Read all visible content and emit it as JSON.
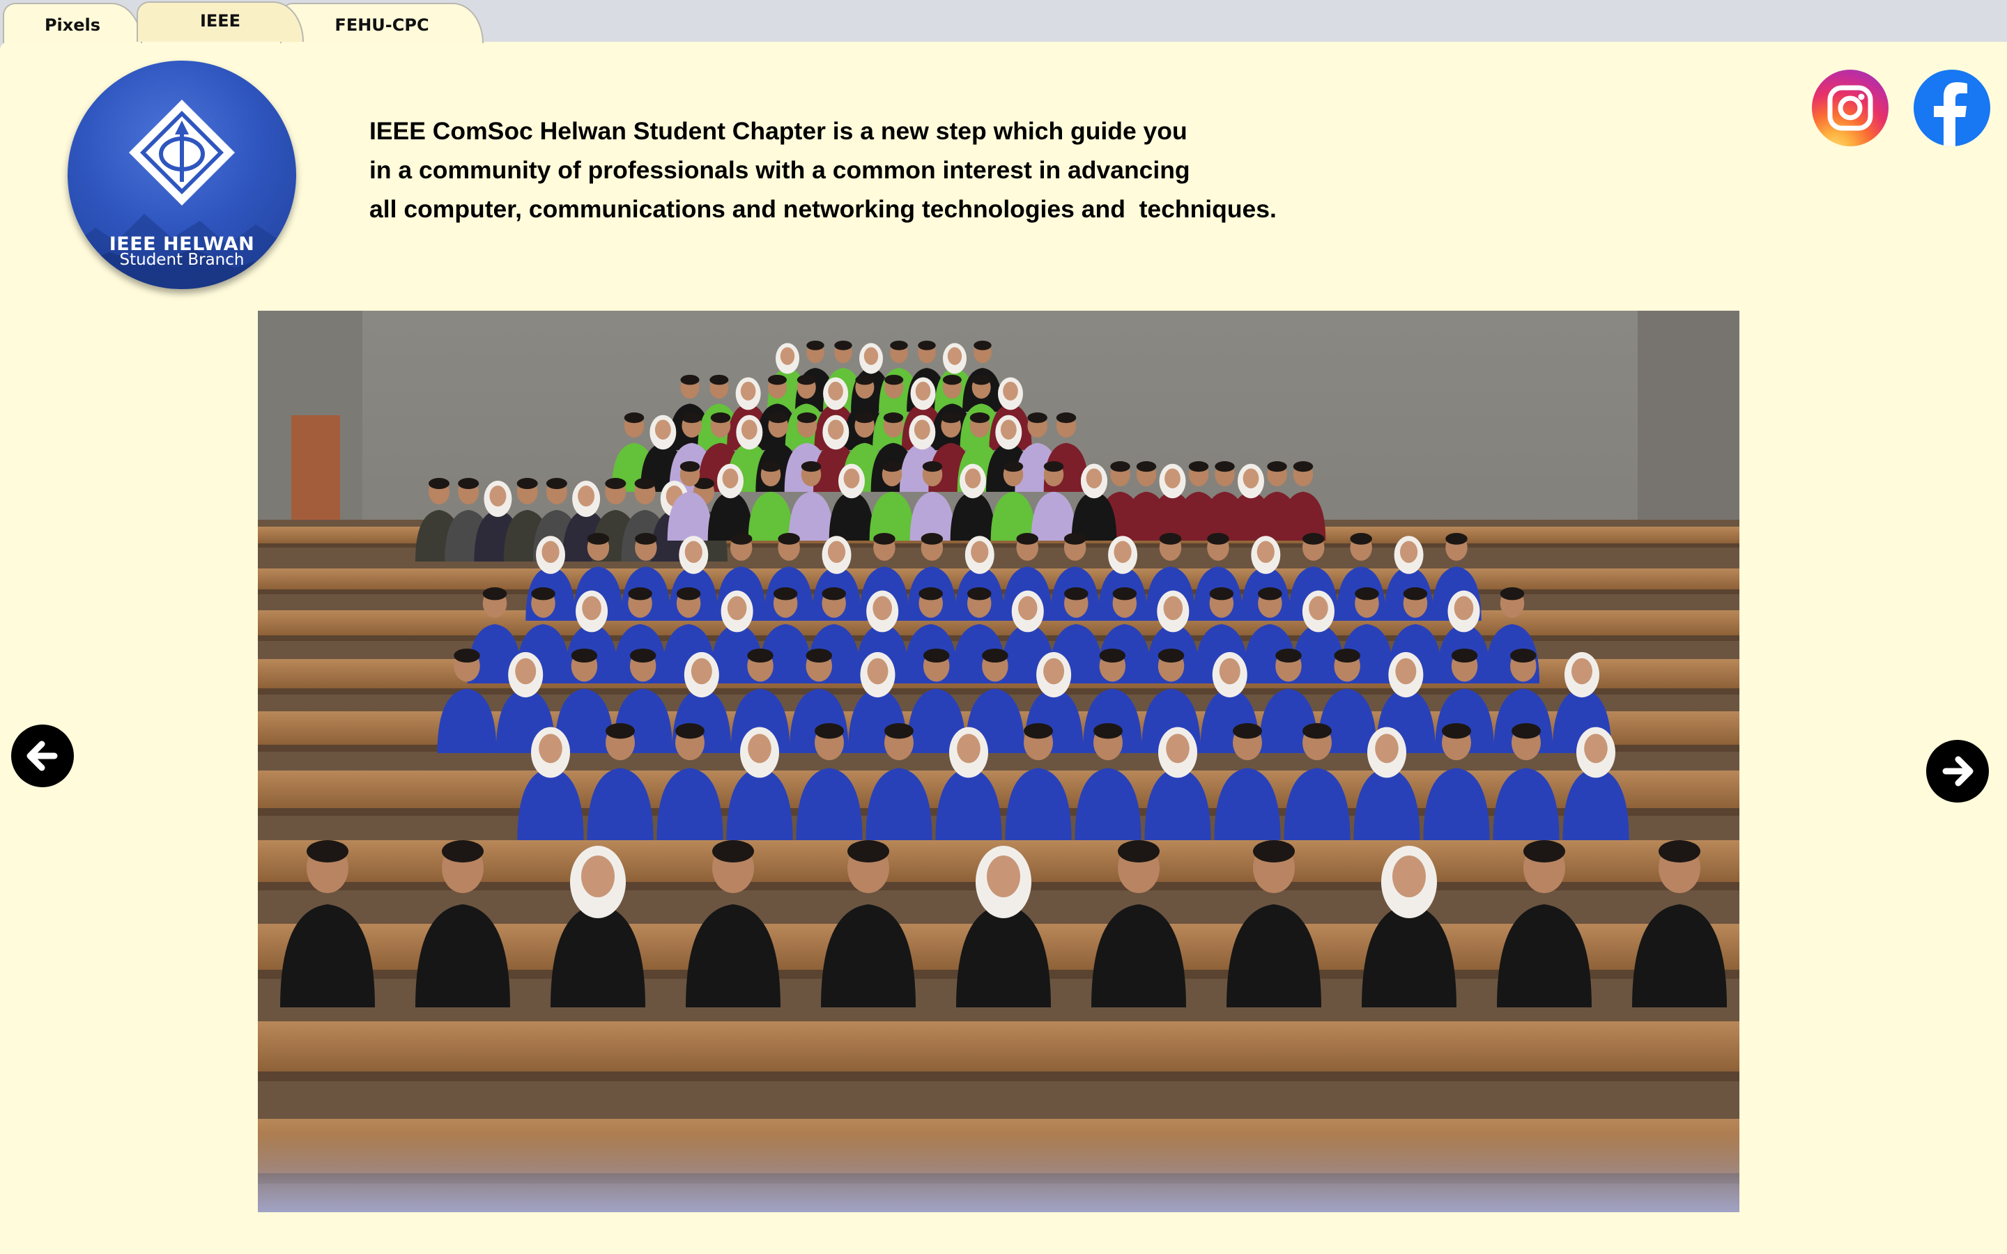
{
  "tabs": [
    {
      "label": "Pixels",
      "active": false
    },
    {
      "label": "IEEE",
      "active": true
    },
    {
      "label": "FEHU-CPC",
      "active": false
    }
  ],
  "logo": {
    "line1": "IEEE HELWAN",
    "line2": "Student Branch",
    "icon": "ieee-diamond-icon"
  },
  "intro": {
    "lines": [
      "IEEE ComSoc Helwan Student Chapter is a new step which guide you",
      "in a community of professionals with a common interest in advancing",
      "all computer, communications and networking technologies and  techniques."
    ]
  },
  "social": {
    "instagram_icon": "instagram-icon",
    "facebook_icon": "facebook-icon"
  },
  "carousel": {
    "prev_icon": "arrow-left-icon",
    "next_icon": "arrow-right-icon"
  },
  "colors": {
    "page_bg": "#fffbdb",
    "tab_active_bg": "#faf0c6",
    "logo_blue": "#2f56bf",
    "jersey_blue": "#2941b8",
    "jersey_green": "#63c13a",
    "jersey_maroon": "#7c1f2a",
    "jersey_black": "#161616",
    "facebook_blue": "#1877f2"
  }
}
